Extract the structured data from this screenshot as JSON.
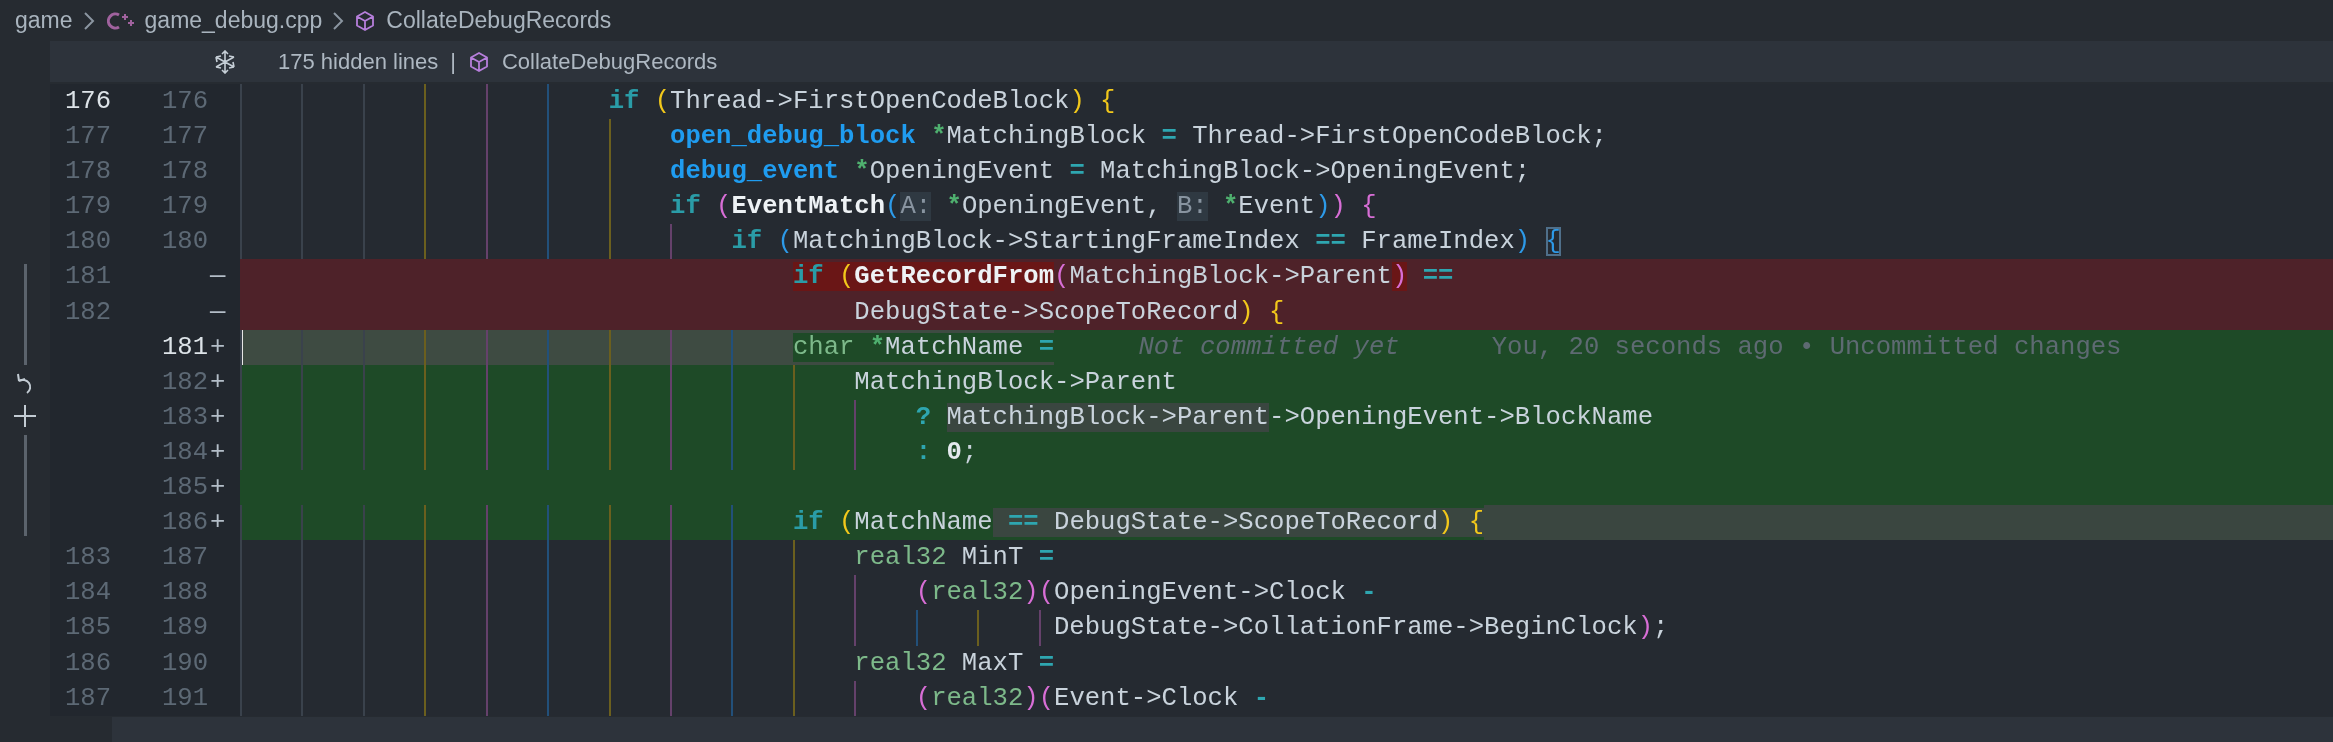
{
  "breadcrumb": {
    "folder": "game",
    "file": "game_debug.cpp",
    "symbol": "CollateDebugRecords"
  },
  "fold_bar": {
    "count": "175 hidden lines",
    "separator": "|",
    "symbol": "CollateDebugRecords"
  },
  "editor": {
    "lines": [
      {
        "old": "176",
        "old_active": true,
        "new": "176",
        "new_active": false,
        "kind": "context",
        "current": false,
        "changed_to_end": false,
        "tokens": [
          {
            "kind": "kw",
            "text": "                        if"
          },
          {
            "kind": "p1",
            "text": " ("
          },
          {
            "kind": "id",
            "text": "Thread->FirstOpenCodeBlock"
          },
          {
            "kind": "p1",
            "text": ")"
          },
          {
            "kind": "p1",
            "text": " {"
          }
        ]
      },
      {
        "old": "177",
        "old_active": false,
        "new": "177",
        "new_active": false,
        "kind": "context",
        "current": false,
        "changed_to_end": false,
        "tokens": [
          {
            "kind": "ty",
            "text": "                            open_debug_block"
          },
          {
            "kind": "ptr",
            "text": " *"
          },
          {
            "kind": "id",
            "text": "MatchingBlock "
          },
          {
            "kind": "op",
            "text": "="
          },
          {
            "kind": "id",
            "text": " Thread->FirstOpenCodeBlock;"
          }
        ]
      },
      {
        "old": "178",
        "old_active": false,
        "new": "178",
        "new_active": false,
        "kind": "context",
        "current": false,
        "changed_to_end": false,
        "tokens": [
          {
            "kind": "ty",
            "text": "                            debug_event"
          },
          {
            "kind": "ptr",
            "text": " *"
          },
          {
            "kind": "id",
            "text": "OpeningEvent "
          },
          {
            "kind": "op",
            "text": "="
          },
          {
            "kind": "id",
            "text": " MatchingBlock->OpeningEvent;"
          }
        ]
      },
      {
        "old": "179",
        "old_active": false,
        "new": "179",
        "new_active": false,
        "kind": "context",
        "current": false,
        "changed_to_end": false,
        "tokens": [
          {
            "kind": "kw",
            "text": "                            if"
          },
          {
            "kind": "p2",
            "text": " ("
          },
          {
            "kind": "fn",
            "text": "EventMatch"
          },
          {
            "kind": "p3",
            "text": "("
          },
          {
            "kind": "hint",
            "text": "A:"
          },
          {
            "kind": "ptr",
            "text": " *"
          },
          {
            "kind": "id",
            "text": "OpeningEvent, "
          },
          {
            "kind": "hint",
            "text": "B:"
          },
          {
            "kind": "ptr",
            "text": " *"
          },
          {
            "kind": "id",
            "text": "Event"
          },
          {
            "kind": "p3",
            "text": ")"
          },
          {
            "kind": "p2",
            "text": ")"
          },
          {
            "kind": "p2",
            "text": " {"
          }
        ]
      },
      {
        "old": "180",
        "old_active": false,
        "new": "180",
        "new_active": false,
        "kind": "context",
        "current": false,
        "changed_to_end": false,
        "tokens": [
          {
            "kind": "kw",
            "text": "                                if"
          },
          {
            "kind": "p3",
            "text": " ("
          },
          {
            "kind": "id",
            "text": "MatchingBlock->StartingFrameIndex "
          },
          {
            "kind": "op",
            "text": "=="
          },
          {
            "kind": "id",
            "text": " FrameIndex"
          },
          {
            "kind": "p3",
            "text": ") ",
            "match": false
          },
          {
            "kind": "p3",
            "text": "{",
            "match": true
          }
        ]
      },
      {
        "old": "181",
        "old_active": false,
        "sign": "—",
        "kind": "removed",
        "current": false,
        "changed_to_end": false,
        "tokens": [
          {
            "kind": "kw",
            "text": "                                    if",
            "changed": true
          },
          {
            "kind": "p1",
            "text": " (",
            "changed": true
          },
          {
            "kind": "fn",
            "text": "GetRecordFrom",
            "changed": true
          },
          {
            "kind": "p2",
            "text": "(",
            "changed": false
          },
          {
            "kind": "id",
            "text": "MatchingBlock->Parent",
            "changed": false
          },
          {
            "kind": "p2",
            "text": ")",
            "changed": true
          },
          {
            "kind": "op",
            "text": " ==",
            "changed": false
          }
        ]
      },
      {
        "old": "182",
        "old_active": false,
        "sign": "—",
        "kind": "removed",
        "current": false,
        "changed_to_end": false,
        "tokens": [
          {
            "kind": "id",
            "text": "                                        DebugState->ScopeToRecord"
          },
          {
            "kind": "p1",
            "text": ")"
          },
          {
            "kind": "p1",
            "text": " {"
          }
        ]
      },
      {
        "new": "181",
        "new_active": true,
        "sign": "+",
        "kind": "added",
        "current": true,
        "changed_to_end": true,
        "blame": {
          "status": "Not committed yet",
          "detail": "You, 20 seconds ago • Uncommitted changes"
        },
        "tokens": [
          {
            "kind": "bt",
            "text": "                                    char",
            "changed": true
          },
          {
            "kind": "ptr",
            "text": " *",
            "changed": true
          },
          {
            "kind": "id",
            "text": "MatchName ",
            "changed": true
          },
          {
            "kind": "op",
            "text": "=",
            "changed": true
          }
        ]
      },
      {
        "new": "182",
        "new_active": false,
        "sign": "+",
        "kind": "added",
        "current": false,
        "changed_to_end": false,
        "tokens": [
          {
            "kind": "id",
            "text": "                                        MatchingBlock->Parent"
          }
        ]
      },
      {
        "new": "183",
        "new_active": false,
        "sign": "+",
        "kind": "added",
        "current": false,
        "changed_to_end": false,
        "tokens": [
          {
            "kind": "op",
            "text": "                                            ? ",
            "changed": false
          },
          {
            "kind": "id",
            "text": "MatchingBlock->Parent",
            "changed": true
          },
          {
            "kind": "id",
            "text": "->OpeningEvent->BlockName",
            "changed": false
          }
        ]
      },
      {
        "new": "184",
        "new_active": false,
        "sign": "+",
        "kind": "added",
        "current": false,
        "changed_to_end": false,
        "tokens": [
          {
            "kind": "op",
            "text": "                                            :"
          },
          {
            "kind": "num",
            "text": " 0"
          },
          {
            "kind": "id",
            "text": ";"
          }
        ]
      },
      {
        "new": "185",
        "new_active": false,
        "sign": "+",
        "kind": "added",
        "current": false,
        "changed_to_end": false
      },
      {
        "new": "186",
        "new_active": false,
        "sign": "+",
        "kind": "added",
        "current": false,
        "changed_to_end": true,
        "tokens": [
          {
            "kind": "kw",
            "text": "                                    if",
            "changed": false
          },
          {
            "kind": "p1",
            "text": " (",
            "changed": false
          },
          {
            "kind": "id",
            "text": "MatchName",
            "changed": false
          },
          {
            "kind": "op",
            "text": " ==",
            "changed": true
          },
          {
            "kind": "id",
            "text": " DebugState->ScopeToRecord",
            "changed": true
          },
          {
            "kind": "p1",
            "text": ")",
            "changed": true
          },
          {
            "kind": "p1",
            "text": " {",
            "changed": true
          }
        ]
      },
      {
        "old": "183",
        "old_active": false,
        "new": "187",
        "new_active": false,
        "kind": "context",
        "current": false,
        "changed_to_end": false,
        "tokens": [
          {
            "kind": "bt",
            "text": "                                        real32"
          },
          {
            "kind": "id",
            "text": " MinT "
          },
          {
            "kind": "op",
            "text": "="
          }
        ]
      },
      {
        "old": "184",
        "old_active": false,
        "new": "188",
        "new_active": false,
        "kind": "context",
        "current": false,
        "changed_to_end": false,
        "tokens": [
          {
            "kind": "p2",
            "text": "                                            ("
          },
          {
            "kind": "bt",
            "text": "real32"
          },
          {
            "kind": "p2",
            "text": ")("
          },
          {
            "kind": "id",
            "text": "OpeningEvent->Clock "
          },
          {
            "kind": "op",
            "text": "-"
          }
        ]
      },
      {
        "old": "185",
        "old_active": false,
        "new": "189",
        "new_active": false,
        "kind": "context",
        "current": false,
        "changed_to_end": false,
        "tokens": [
          {
            "kind": "id",
            "text": "                                                     DebugState->CollationFrame->BeginClock"
          },
          {
            "kind": "p2",
            "text": ")"
          },
          {
            "kind": "id",
            "text": ";"
          }
        ]
      },
      {
        "old": "186",
        "old_active": false,
        "new": "190",
        "new_active": false,
        "kind": "context",
        "current": false,
        "changed_to_end": false,
        "tokens": [
          {
            "kind": "bt",
            "text": "                                        real32"
          },
          {
            "kind": "id",
            "text": " MaxT "
          },
          {
            "kind": "op",
            "text": "="
          }
        ]
      },
      {
        "old": "187",
        "old_active": false,
        "new": "191",
        "new_active": false,
        "kind": "context",
        "current": false,
        "changed_to_end": false,
        "tokens": [
          {
            "kind": "p2",
            "text": "                                            ("
          },
          {
            "kind": "bt",
            "text": "real32"
          },
          {
            "kind": "p2",
            "text": ")("
          },
          {
            "kind": "id",
            "text": "Event->Clock "
          },
          {
            "kind": "op",
            "text": "-"
          }
        ]
      }
    ]
  }
}
